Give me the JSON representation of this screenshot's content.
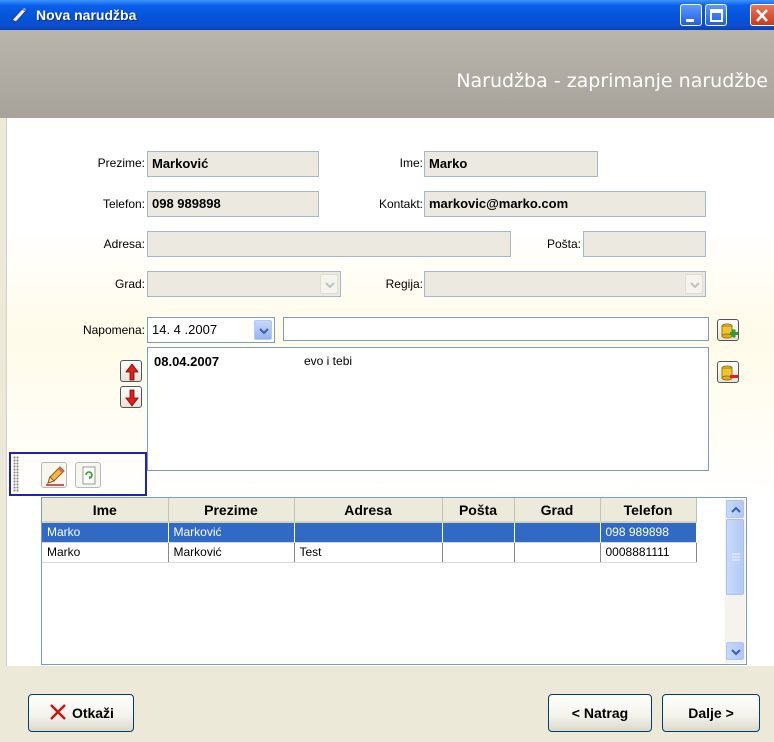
{
  "window": {
    "title": "Nova narudžba"
  },
  "banner": {
    "heading": "Narudžba - zaprimanje narudžbe"
  },
  "form": {
    "prezime_label": "Prezime:",
    "prezime_value": "Marković",
    "ime_label": "Ime:",
    "ime_value": "Marko",
    "telefon_label": "Telefon:",
    "telefon_value": "098 989898",
    "kontakt_label": "Kontakt:",
    "kontakt_value": "markovic@marko.com",
    "adresa_label": "Adresa:",
    "adresa_value": "",
    "posta_label": "Pošta:",
    "posta_value": "",
    "grad_label": "Grad:",
    "grad_value": "",
    "regija_label": "Regija:",
    "regija_value": "",
    "napomena_label": "Napomena:",
    "napomena_date": "14. 4 .2007",
    "napomena_text": ""
  },
  "notes": [
    {
      "date": "08.04.2007",
      "text": "evo i tebi"
    }
  ],
  "grid": {
    "columns": [
      "Ime",
      "Prezime",
      "Adresa",
      "Pošta",
      "Grad",
      "Telefon"
    ],
    "rows": [
      [
        "Marko",
        "Marković",
        "",
        "",
        "",
        "098 989898"
      ],
      [
        "Marko",
        "Marković",
        "Test",
        "",
        "",
        "0008881111"
      ]
    ],
    "selected_row": 0
  },
  "footer": {
    "cancel_label": "Otkaži",
    "back_label": "< Natrag",
    "next_label": "Dalje >"
  },
  "colors": {
    "title_bar": "#0453d8",
    "selection": "#316ac5",
    "banner": "#a7a39b"
  }
}
